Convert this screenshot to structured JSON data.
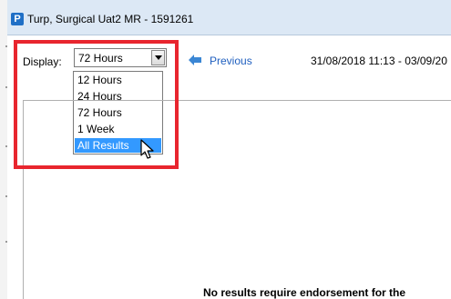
{
  "window": {
    "app_icon_letter": "P",
    "title": "Turp, Surgical Uat2  MR - 1591261"
  },
  "toolbar": {
    "display_label": "Display:",
    "display_value": "72 Hours",
    "previous_label": "Previous",
    "date_range": "31/08/2018 11:13 - 03/09/20"
  },
  "dropdown": {
    "options": [
      "12 Hours",
      "24 Hours",
      "72 Hours",
      "1 Week",
      "All Results"
    ],
    "selected_index": 4
  },
  "main": {
    "message": "No results require endorsement for the"
  },
  "colors": {
    "highlight": "#e8252e",
    "selection": "#3399ff",
    "link": "#1f5fbf",
    "titlebar": "#dce8f5"
  }
}
